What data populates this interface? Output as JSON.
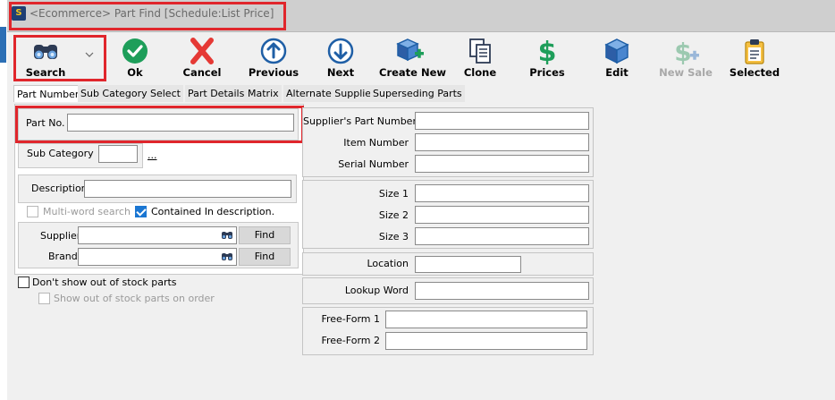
{
  "window": {
    "title": "<Ecommerce> Part Find [Schedule:List Price]",
    "app_icon_text": "S"
  },
  "toolbar": {
    "buttons": [
      {
        "label": "Search",
        "icon": "binoculars-icon",
        "enabled": true
      },
      {
        "label": "Ok",
        "icon": "check-circle-icon",
        "enabled": true
      },
      {
        "label": "Cancel",
        "icon": "x-icon",
        "enabled": true
      },
      {
        "label": "Previous",
        "icon": "arrow-up-circle-icon",
        "enabled": true
      },
      {
        "label": "Next",
        "icon": "arrow-down-circle-icon",
        "enabled": true
      },
      {
        "label": "Create New",
        "icon": "box-plus-icon",
        "enabled": true
      },
      {
        "label": "Clone",
        "icon": "copy-icon",
        "enabled": true
      },
      {
        "label": "Prices",
        "icon": "dollar-icon",
        "enabled": true
      },
      {
        "label": "Edit",
        "icon": "box-icon",
        "enabled": true
      },
      {
        "label": "New Sale",
        "icon": "dollar-plus-icon",
        "enabled": false
      },
      {
        "label": "Selected",
        "icon": "clipboard-icon",
        "enabled": true
      }
    ]
  },
  "tabs": [
    "Part Number",
    "Sub Category",
    "Select",
    "Part Details",
    "Matrix",
    "Alternate Supplier",
    "Superseding Parts"
  ],
  "left": {
    "part_no_label": "Part No.",
    "part_no_value": "",
    "sub_category_label": "Sub Category",
    "sub_category_value": "",
    "ellipsis": "...",
    "description_label": "Description",
    "description_value": "",
    "multiword_label": "Multi-word search",
    "contained_label": "Contained In description.",
    "supplier_label": "Supplier",
    "supplier_value": "",
    "brand_label": "Brand",
    "brand_value": "",
    "find_label": "Find",
    "dont_show_label": "Don't show out of stock parts",
    "show_on_order_label": "Show out of stock parts on order"
  },
  "right": {
    "suppliers_part_number_label": "Supplier's Part Number",
    "item_number_label": "Item Number",
    "serial_number_label": "Serial Number",
    "size1_label": "Size 1",
    "size2_label": "Size 2",
    "size3_label": "Size 3",
    "location_label": "Location",
    "lookup_word_label": "Lookup Word",
    "free_form1_label": "Free-Form 1",
    "free_form2_label": "Free-Form 2"
  },
  "colors": {
    "highlight_red": "#e0262c",
    "green": "#1e9e5a",
    "red": "#e53935",
    "blue": "#1f5fa6",
    "disabled": "#a8a8a8"
  }
}
